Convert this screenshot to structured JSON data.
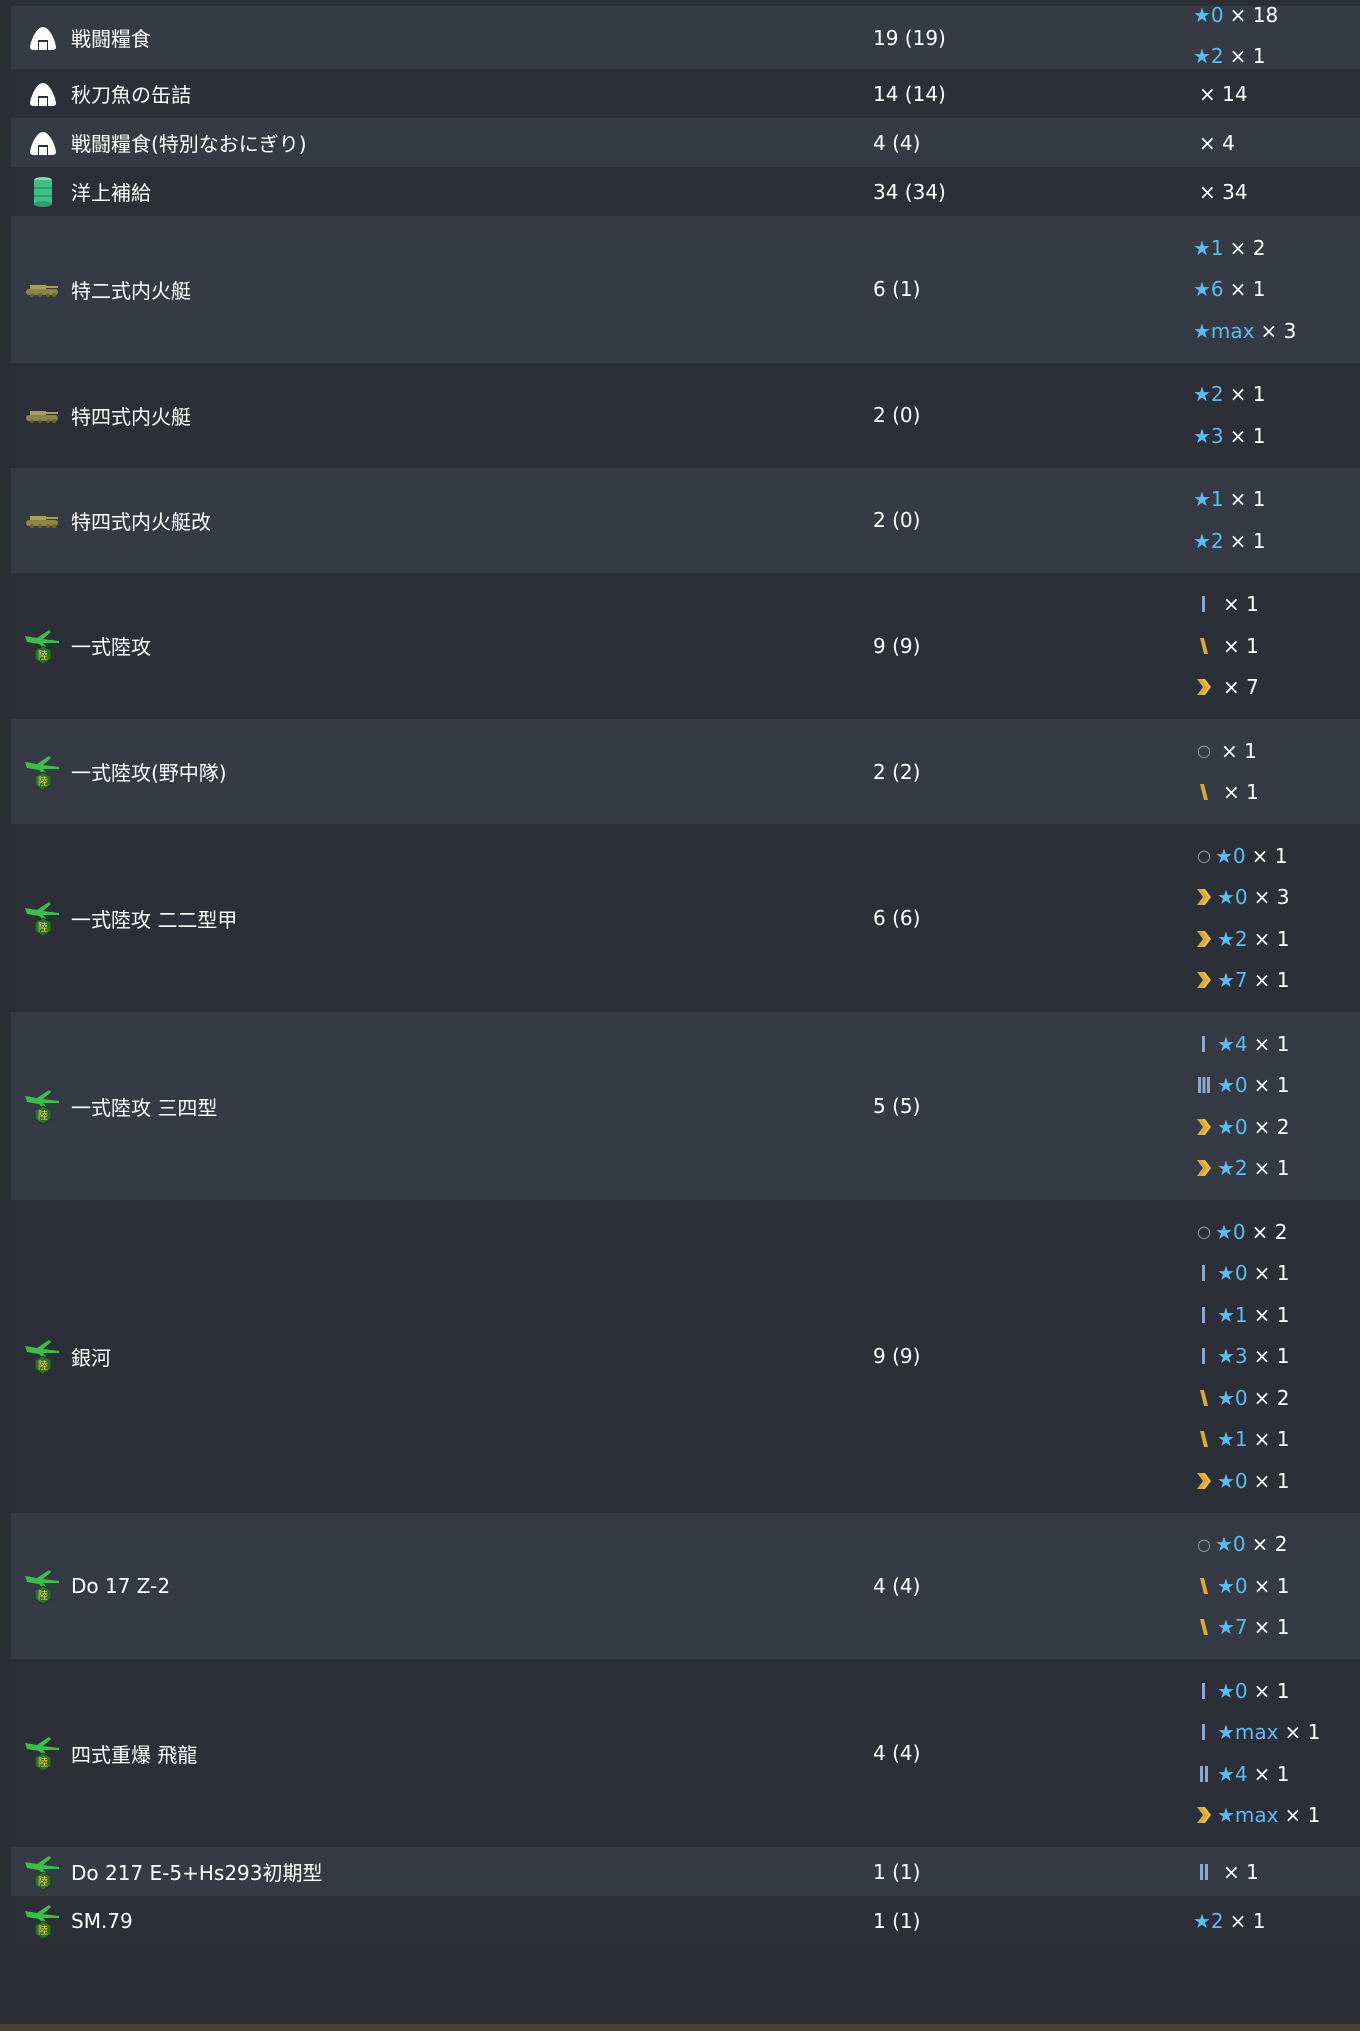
{
  "rows": [
    {
      "icon": "rations-icon",
      "name": "戦闘糧食",
      "count": "19 (19)",
      "details": [
        {
          "prof": "",
          "star": "★0",
          "mult": "× 18"
        },
        {
          "prof": "",
          "star": "★2",
          "mult": "× 1"
        }
      ]
    },
    {
      "icon": "rations-icon",
      "name": "秋刀魚の缶詰",
      "count": "14 (14)",
      "details": [
        {
          "prof": "",
          "star": "",
          "mult": "× 14"
        }
      ]
    },
    {
      "icon": "rations-icon",
      "name": "戦闘糧食(特別なおにぎり)",
      "count": "4 (4)",
      "details": [
        {
          "prof": "",
          "star": "",
          "mult": "× 4"
        }
      ]
    },
    {
      "icon": "drum-icon",
      "name": "洋上補給",
      "count": "34 (34)",
      "details": [
        {
          "prof": "",
          "star": "",
          "mult": "× 34"
        }
      ]
    },
    {
      "icon": "tank-icon",
      "name": "特二式内火艇",
      "count": "6 (1)",
      "details": [
        {
          "prof": "",
          "star": "★1",
          "mult": "× 2"
        },
        {
          "prof": "",
          "star": "★6",
          "mult": "× 1"
        },
        {
          "prof": "",
          "star": "★max",
          "mult": "× 3"
        }
      ]
    },
    {
      "icon": "tank-icon",
      "name": "特四式内火艇",
      "count": "2 (0)",
      "details": [
        {
          "prof": "",
          "star": "★2",
          "mult": "× 1"
        },
        {
          "prof": "",
          "star": "★3",
          "mult": "× 1"
        }
      ]
    },
    {
      "icon": "tank-icon",
      "name": "特四式内火艇改",
      "count": "2 (0)",
      "details": [
        {
          "prof": "",
          "star": "★1",
          "mult": "× 1"
        },
        {
          "prof": "",
          "star": "★2",
          "mult": "× 1"
        }
      ]
    },
    {
      "icon": "land-bomber-icon",
      "name": "一式陸攻",
      "count": "9 (9)",
      "details": [
        {
          "prof": "bar1",
          "star": "",
          "mult": "× 1"
        },
        {
          "prof": "slash",
          "star": "",
          "mult": "× 1"
        },
        {
          "prof": "chevron",
          "star": "",
          "mult": "× 7"
        }
      ]
    },
    {
      "icon": "land-bomber-icon",
      "name": "一式陸攻(野中隊)",
      "count": "2 (2)",
      "details": [
        {
          "prof": "circle",
          "star": "",
          "mult": "× 1"
        },
        {
          "prof": "slash",
          "star": "",
          "mult": "× 1"
        }
      ]
    },
    {
      "icon": "land-bomber-icon",
      "name": "一式陸攻 二二型甲",
      "count": "6 (6)",
      "details": [
        {
          "prof": "circle",
          "star": "★0",
          "mult": "× 1"
        },
        {
          "prof": "chevron",
          "star": "★0",
          "mult": "× 3"
        },
        {
          "prof": "chevron",
          "star": "★2",
          "mult": "× 1"
        },
        {
          "prof": "chevron",
          "star": "★7",
          "mult": "× 1"
        }
      ]
    },
    {
      "icon": "land-bomber-icon",
      "name": "一式陸攻 三四型",
      "count": "5 (5)",
      "details": [
        {
          "prof": "bar1",
          "star": "★4",
          "mult": "× 1"
        },
        {
          "prof": "bar3",
          "star": "★0",
          "mult": "× 1"
        },
        {
          "prof": "chevron",
          "star": "★0",
          "mult": "× 2"
        },
        {
          "prof": "chevron",
          "star": "★2",
          "mult": "× 1"
        }
      ]
    },
    {
      "icon": "land-bomber-icon",
      "name": "銀河",
      "count": "9 (9)",
      "details": [
        {
          "prof": "circle",
          "star": "★0",
          "mult": "× 2"
        },
        {
          "prof": "bar1",
          "star": "★0",
          "mult": "× 1"
        },
        {
          "prof": "bar1",
          "star": "★1",
          "mult": "× 1"
        },
        {
          "prof": "bar1",
          "star": "★3",
          "mult": "× 1"
        },
        {
          "prof": "slash",
          "star": "★0",
          "mult": "× 2"
        },
        {
          "prof": "slash",
          "star": "★1",
          "mult": "× 1"
        },
        {
          "prof": "chevron",
          "star": "★0",
          "mult": "× 1"
        }
      ]
    },
    {
      "icon": "land-bomber-icon",
      "name": "Do 17 Z-2",
      "count": "4 (4)",
      "details": [
        {
          "prof": "circle",
          "star": "★0",
          "mult": "× 2"
        },
        {
          "prof": "slash",
          "star": "★0",
          "mult": "× 1"
        },
        {
          "prof": "slash",
          "star": "★7",
          "mult": "× 1"
        }
      ]
    },
    {
      "icon": "land-bomber-icon",
      "name": "四式重爆 飛龍",
      "count": "4 (4)",
      "details": [
        {
          "prof": "bar1",
          "star": "★0",
          "mult": "× 1"
        },
        {
          "prof": "bar1",
          "star": "★max",
          "mult": "× 1"
        },
        {
          "prof": "bar2",
          "star": "★4",
          "mult": "× 1"
        },
        {
          "prof": "chevron",
          "star": "★max",
          "mult": "× 1"
        }
      ]
    },
    {
      "icon": "land-bomber-icon",
      "name": "Do 217 E-5+Hs293初期型",
      "count": "1 (1)",
      "details": [
        {
          "prof": "bar2",
          "star": "",
          "mult": "× 1"
        }
      ]
    },
    {
      "icon": "land-bomber-icon",
      "name": "SM.79",
      "count": "1 (1)",
      "details": [
        {
          "prof": "",
          "star": "★2",
          "mult": "× 1"
        }
      ]
    }
  ],
  "colors": {
    "star": "#5bbcf0",
    "prof_blue": "#8fa7cc",
    "prof_gold": "#d9a93a",
    "row_odd": "#363a44",
    "row_even": "#2c2f37"
  }
}
